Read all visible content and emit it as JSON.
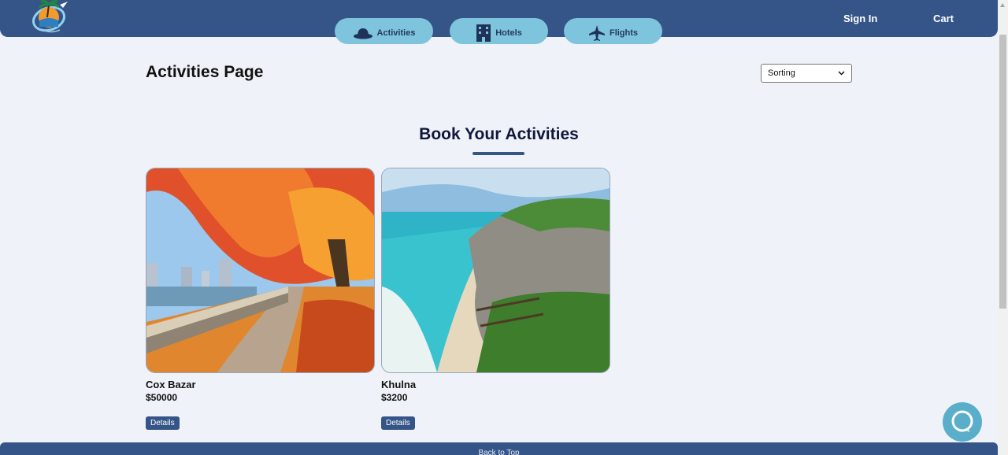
{
  "header": {
    "tabs": [
      {
        "label": "Activities",
        "icon": "hat-icon"
      },
      {
        "label": "Hotels",
        "icon": "building-icon"
      },
      {
        "label": "Flights",
        "icon": "plane-icon"
      }
    ],
    "sign_in": "Sign In",
    "cart": "Cart"
  },
  "main": {
    "page_title": "Activities Page",
    "sort": {
      "selected": "Sorting"
    },
    "section_title": "Book Your Activities",
    "cards": [
      {
        "name": "Cox Bazar",
        "price": "$50000",
        "button": "Details",
        "image": "autumn-park-image"
      },
      {
        "name": "Khulna",
        "price": "$3200",
        "button": "Details",
        "image": "beach-cliff-image"
      }
    ]
  },
  "footer": {
    "back_to_top": "Back to Top"
  },
  "colors": {
    "header": "#355487",
    "tab": "#7ec4dc",
    "background": "#eff3f9",
    "chat": "#5aaec9"
  }
}
